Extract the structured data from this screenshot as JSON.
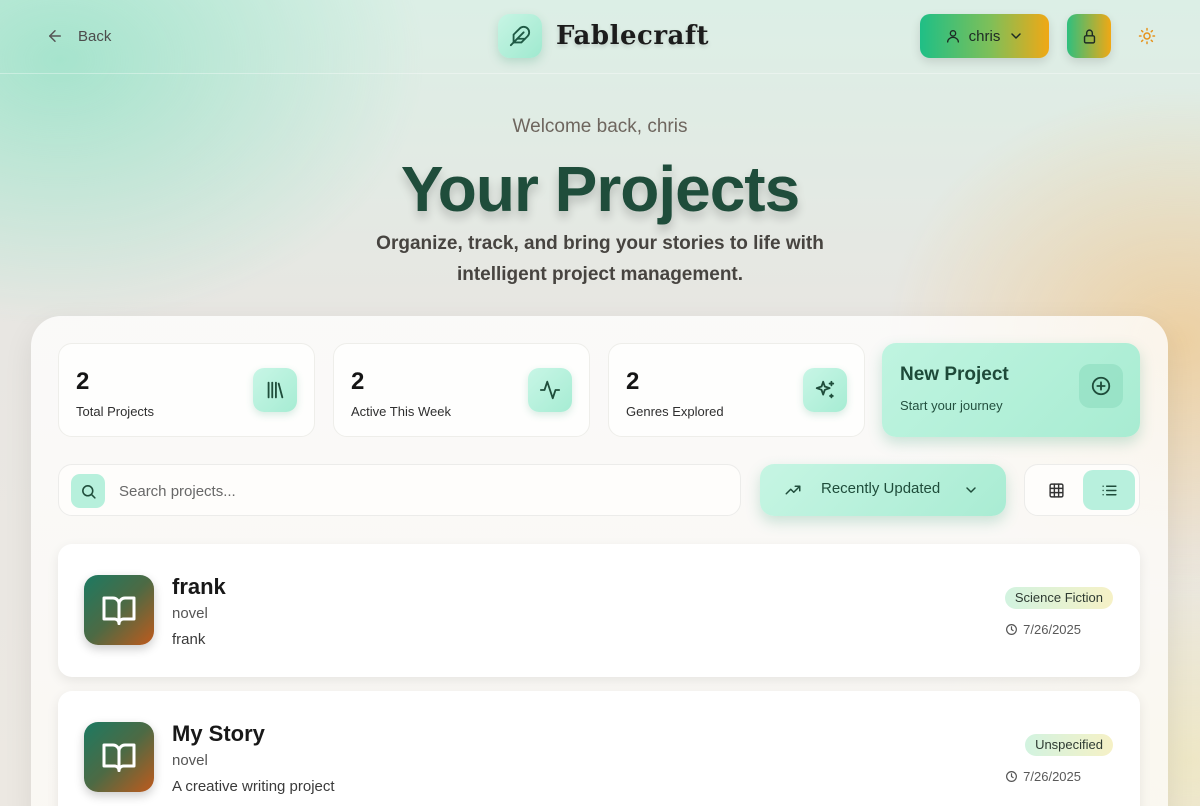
{
  "header": {
    "back_label": "Back",
    "brand_name": "Fablecraft",
    "user_name": "chris",
    "icons": {
      "back": "arrow-left-icon",
      "brand": "feather-icon",
      "user": "user-icon",
      "user_menu": "chevron-down-icon",
      "lock": "lock-icon",
      "theme": "sun-icon"
    }
  },
  "hero": {
    "welcome": "Welcome back, chris",
    "title": "Your Projects",
    "subtitle": "Organize, track, and bring your stories to life with intelligent project management."
  },
  "stats": [
    {
      "value": "2",
      "label": "Total Projects",
      "icon": "library-icon"
    },
    {
      "value": "2",
      "label": "Active This Week",
      "icon": "activity-icon"
    },
    {
      "value": "2",
      "label": "Genres Explored",
      "icon": "sparkles-icon"
    }
  ],
  "new_project": {
    "title": "New Project",
    "subtitle": "Start your journey",
    "icon": "plus-circle-icon"
  },
  "toolbar": {
    "search_placeholder": "Search projects...",
    "sort_label": "Recently Updated",
    "view_modes": [
      "grid",
      "list"
    ],
    "active_view": "list"
  },
  "projects": [
    {
      "name": "frank",
      "type": "novel",
      "description": "frank",
      "genre": "Science Fiction",
      "date": "7/26/2025"
    },
    {
      "name": "My Story",
      "type": "novel",
      "description": "A creative writing project",
      "genre": "Unspecified",
      "date": "7/26/2025"
    }
  ],
  "colors": {
    "accent_mint": "#a9ecd3",
    "accent_dark_green": "#1f4d3b",
    "accent_amber": "#f0a815",
    "brand_gradient_start": "#1fbf86"
  }
}
